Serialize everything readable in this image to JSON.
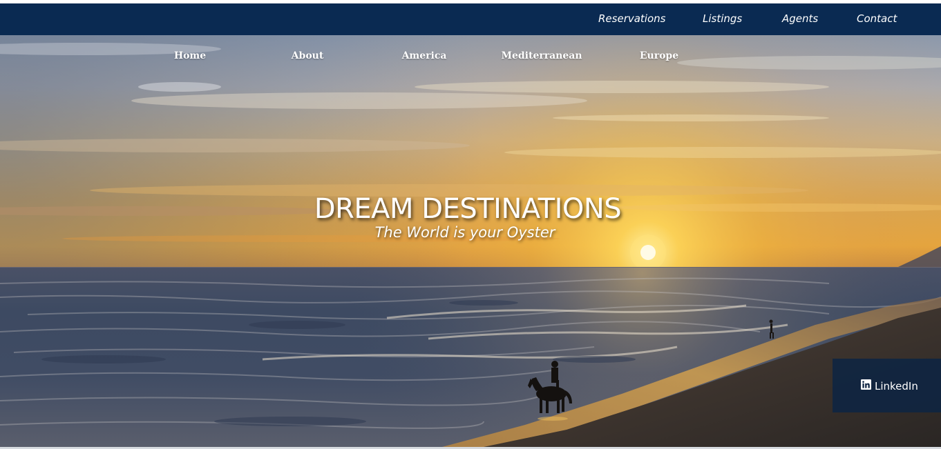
{
  "top_nav": {
    "items": [
      {
        "label": "Reservations"
      },
      {
        "label": "Listings"
      },
      {
        "label": "Agents"
      },
      {
        "label": "Contact"
      }
    ]
  },
  "main_nav": {
    "items": [
      {
        "label": "Home"
      },
      {
        "label": "About"
      },
      {
        "label": "America"
      },
      {
        "label": "Mediterranean"
      },
      {
        "label": "Europe"
      }
    ]
  },
  "hero": {
    "title": "DREAM DESTINATIONS",
    "subtitle": "The World is your Oyster"
  },
  "social": {
    "linkedin_label": "LinkedIn",
    "icon": "linkedin-icon"
  },
  "colors": {
    "top_bar": "#0a2a52",
    "social_box": "#0e2442"
  }
}
